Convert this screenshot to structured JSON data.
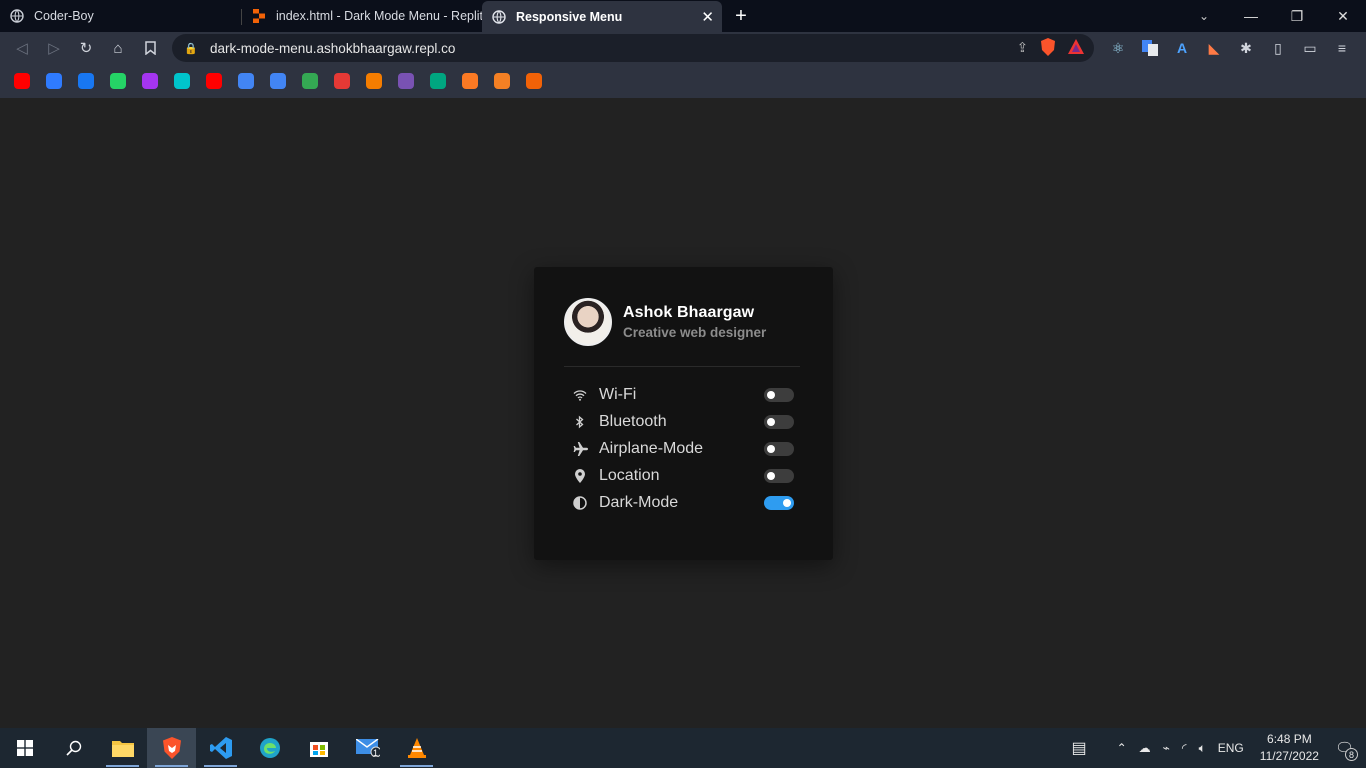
{
  "tabs": [
    {
      "title": "Coder-Boy",
      "icon": "globe-icon"
    },
    {
      "title": "index.html - Dark Mode Menu - Replit",
      "icon": "replit-icon"
    },
    {
      "title": "Responsive Menu",
      "icon": "globe-icon",
      "active": true
    }
  ],
  "address_bar": {
    "url": "dark-mode-menu.ashokbhaargaw.repl.co"
  },
  "bookmarks": [
    {
      "icon": "youtube-icon",
      "color": "#ff0000"
    },
    {
      "icon": "calendar-icon",
      "color": "#2f7bff"
    },
    {
      "icon": "facebook-icon",
      "color": "#1877f2"
    },
    {
      "icon": "whatsapp-icon",
      "color": "#25d366"
    },
    {
      "icon": "udemy-icon",
      "color": "#a435f0"
    },
    {
      "icon": "canva-icon",
      "color": "#00c4cc"
    },
    {
      "icon": "youtube-icon",
      "color": "#ff0000"
    },
    {
      "icon": "play-icon",
      "color": "#4285f4"
    },
    {
      "icon": "translate-icon",
      "color": "#4285f4"
    },
    {
      "icon": "drive-icon",
      "color": "#34a853"
    },
    {
      "icon": "download-icon",
      "color": "#e53935"
    },
    {
      "icon": "blogger-icon",
      "color": "#f57d00"
    },
    {
      "icon": "bootstrap-icon",
      "color": "#7952b3"
    },
    {
      "icon": "webflow-icon",
      "color": "#00a680"
    },
    {
      "icon": "xampp-icon",
      "color": "#fb7a24"
    },
    {
      "icon": "stackoverflow-icon",
      "color": "#f48024"
    },
    {
      "icon": "replit-icon",
      "color": "#f26207"
    }
  ],
  "profile": {
    "name": "Ashok Bhaargaw",
    "role": "Creative web designer"
  },
  "menu_items": [
    {
      "label": "Wi-Fi",
      "icon": "wifi-icon",
      "on": false
    },
    {
      "label": "Bluetooth",
      "icon": "bluetooth-icon",
      "on": false
    },
    {
      "label": "Airplane-Mode",
      "icon": "airplane-icon",
      "on": false
    },
    {
      "label": "Location",
      "icon": "location-pin-icon",
      "on": false
    },
    {
      "label": "Dark-Mode",
      "icon": "half-circle-icon",
      "on": true
    }
  ],
  "colors": {
    "toggle_on": "#2e9cf0",
    "toggle_off": "#3d3d3d",
    "card_bg": "#121212",
    "page_bg": "#222222"
  },
  "taskbar": {
    "language": "ENG",
    "time": "6:48 PM",
    "date": "11/27/2022",
    "mail_badge": "1",
    "notification_count": "8"
  }
}
